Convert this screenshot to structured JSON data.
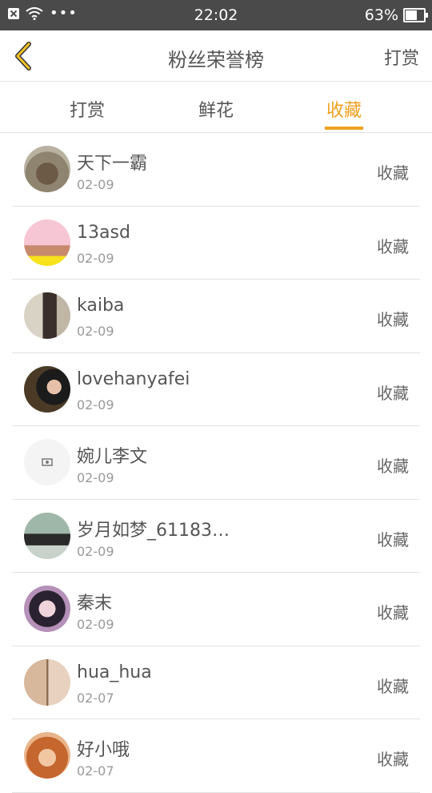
{
  "status": {
    "time": "22:02",
    "battery": "63%",
    "battery_level": 0.63,
    "dots": "•••"
  },
  "nav": {
    "title": "粉丝荣誉榜",
    "right_label": "打赏",
    "back_icon": "chevron-left-icon"
  },
  "tabs": [
    {
      "label": "打赏",
      "active": false
    },
    {
      "label": "鲜花",
      "active": false
    },
    {
      "label": "收藏",
      "active": true
    }
  ],
  "colors": {
    "accent": "#f0a020",
    "statusbar": "#4a4a4a"
  },
  "list": [
    {
      "name": "天下一霸",
      "date": "02-09",
      "action": "收藏"
    },
    {
      "name": "13asd",
      "date": "02-09",
      "action": "收藏"
    },
    {
      "name": "kaiba",
      "date": "02-09",
      "action": "收藏"
    },
    {
      "name": "lovehanyafei",
      "date": "02-09",
      "action": "收藏"
    },
    {
      "name": "婉儿李文",
      "date": "02-09",
      "action": "收藏"
    },
    {
      "name": "岁月如梦_61183…",
      "date": "02-09",
      "action": "收藏"
    },
    {
      "name": "秦末",
      "date": "02-09",
      "action": "收藏"
    },
    {
      "name": "hua_hua",
      "date": "02-07",
      "action": "收藏"
    },
    {
      "name": "好小哦",
      "date": "02-07",
      "action": "收藏"
    }
  ]
}
